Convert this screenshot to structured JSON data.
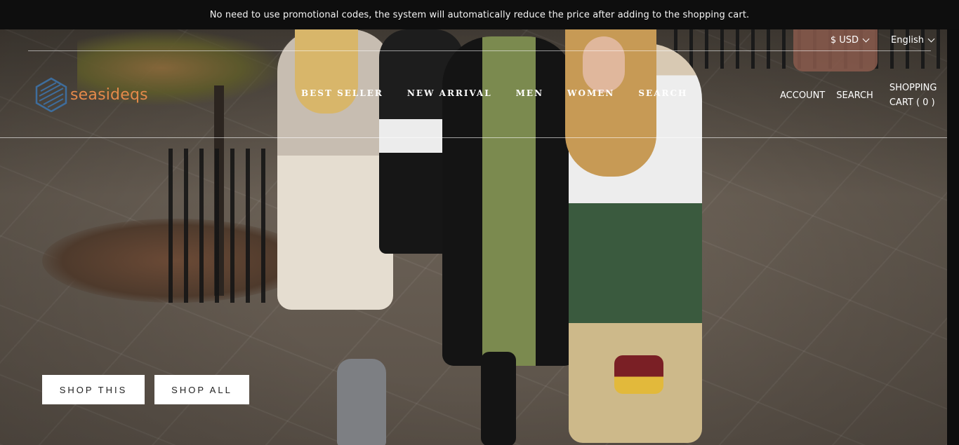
{
  "announcement": "No need to use promotional codes, the system will automatically reduce the price after adding to the shopping cart.",
  "utility": {
    "currency": "$ USD",
    "language": "English"
  },
  "logo": {
    "text": "seasideqs",
    "color": "#e58a4a",
    "icon": "cube-logo-icon"
  },
  "nav": [
    {
      "label": "BEST SELLER"
    },
    {
      "label": "NEW ARRIVAL"
    },
    {
      "label": "MEN"
    },
    {
      "label": "WOMEN"
    },
    {
      "label": "SEARCH"
    }
  ],
  "right_nav": {
    "account": "ACCOUNT",
    "search": "SEARCH",
    "cart_line1": "SHOPPING",
    "cart_line2": "CART ( 0 )"
  },
  "hero": {
    "cta_primary": "SHOP THIS",
    "cta_secondary": "SHOP ALL"
  }
}
